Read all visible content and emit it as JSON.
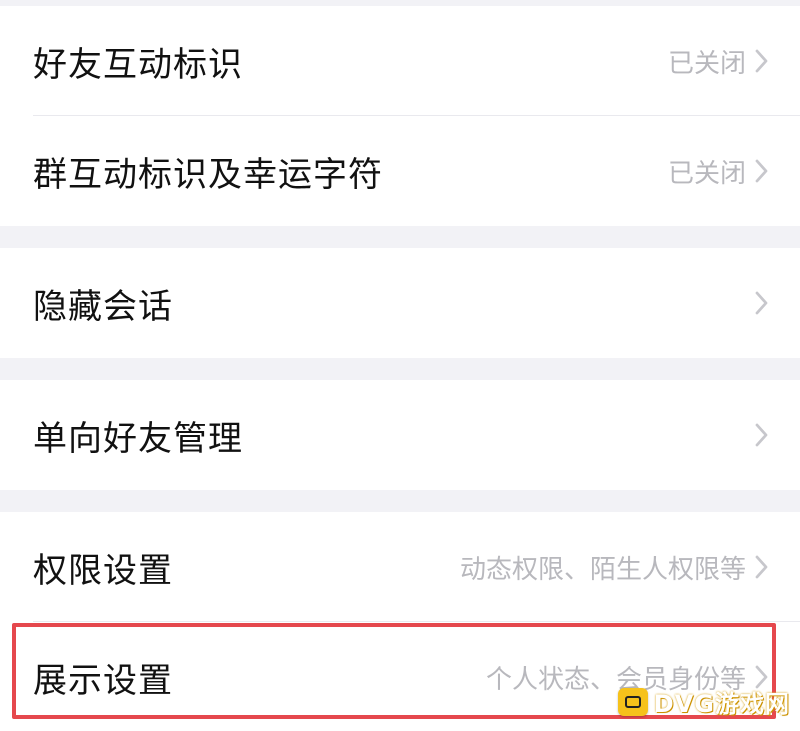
{
  "settings": {
    "rows": [
      {
        "title": "好友互动标识",
        "value": "已关闭"
      },
      {
        "title": "群互动标识及幸运字符",
        "value": "已关闭"
      },
      {
        "title": "隐藏会话",
        "value": ""
      },
      {
        "title": "单向好友管理",
        "value": ""
      },
      {
        "title": "权限设置",
        "value": "动态权限、陌生人权限等"
      },
      {
        "title": "展示设置",
        "value": "个人状态、会员身份等"
      }
    ]
  },
  "watermark": {
    "text": "DVG游戏网"
  },
  "colors": {
    "background": "#f2f2f6",
    "row_background": "#ffffff",
    "highlight": "#e5484d",
    "secondary_text": "#b8b8bd"
  },
  "icons": {
    "chevron": "chevron-right-icon",
    "logo": "gamepad-icon"
  }
}
